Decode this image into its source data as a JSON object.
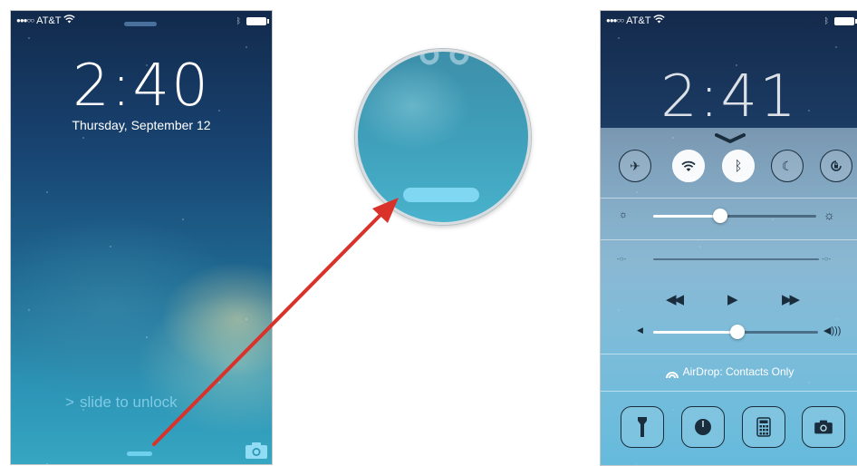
{
  "lock_screen": {
    "carrier": "AT&T",
    "signal": "●●●○○",
    "time": "2:40",
    "date": "Thursday, September 12",
    "slide_text": "slide to unlock",
    "slide_chevron": ">"
  },
  "control_center": {
    "carrier": "AT&T",
    "signal": "●●●○○",
    "time": "2:41",
    "toggles": [
      "airplane",
      "wifi",
      "bluetooth",
      "do-not-disturb",
      "rotation-lock"
    ],
    "toggle_states": [
      false,
      true,
      true,
      false,
      false
    ],
    "brightness_level": 0.41,
    "volume_level": 0.51,
    "media_controls": {
      "rewind": "◀◀",
      "play": "▶",
      "forward": "▶▶"
    },
    "airdrop_label": "AirDrop: Contacts Only",
    "shortcuts": [
      "flashlight",
      "timer",
      "calculator",
      "camera"
    ]
  },
  "colors": {
    "arrow": "#d9322a",
    "handle": "#6fd0ee"
  },
  "icons": {
    "wifi": "wifi-icon",
    "battery": "battery-icon",
    "bluetooth": "bluetooth-icon",
    "camera": "camera-icon"
  }
}
